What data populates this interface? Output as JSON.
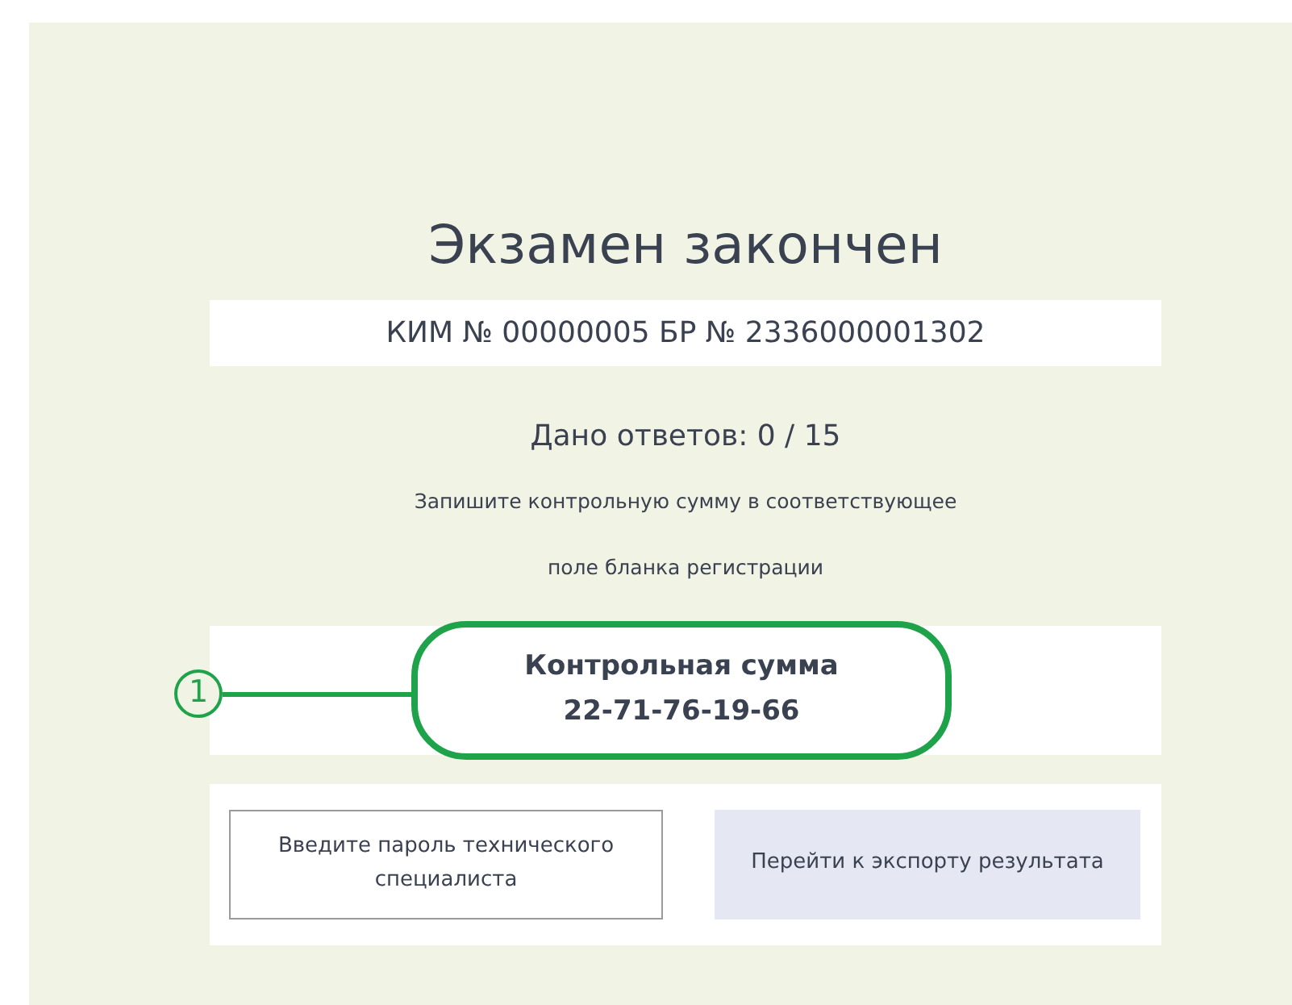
{
  "title": "Экзамен закончен",
  "identifiers": "КИМ № 00000005 БР № 2336000001302",
  "answers": "Дано ответов: 0 / 15",
  "instruction": [
    "Запишите контрольную сумму в соответствующее",
    "поле бланка регистрации"
  ],
  "checksum": {
    "label": "Контрольная сумма",
    "value": "22-71-76-19-66",
    "highlighted": true
  },
  "callout": {
    "number": "1"
  },
  "buttons": [
    {
      "label": "Введите пароль технического специалиста",
      "kind": "outline"
    },
    {
      "label": "Перейти к экспорту результата",
      "kind": "filled"
    }
  ]
}
